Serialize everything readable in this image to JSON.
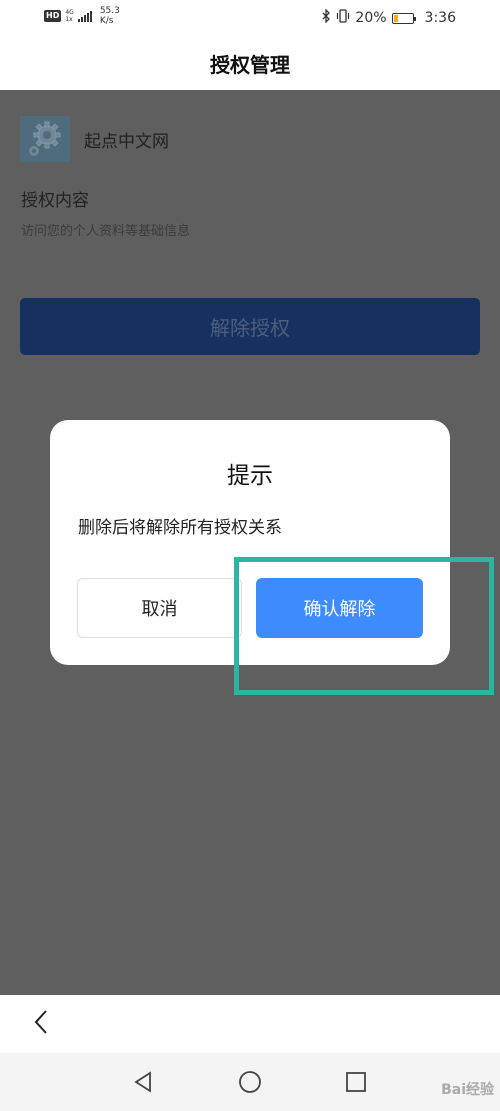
{
  "status_bar": {
    "hd": "HD",
    "network_gen": "4G",
    "network_sub": "1x",
    "speed_value": "55.3",
    "speed_unit": "K/s",
    "battery_percent": "20%",
    "battery_level": 0.2,
    "time": "3:36"
  },
  "header": {
    "title": "授权管理"
  },
  "app": {
    "name": "起点中文网",
    "logo_icon": "gear-icon"
  },
  "auth": {
    "content_label": "授权内容",
    "content_desc": "访问您的个人资料等基础信息",
    "revoke_label": "解除授权"
  },
  "dialog": {
    "title": "提示",
    "message": "删除后将解除所有授权关系",
    "cancel_label": "取消",
    "confirm_label": "确认解除"
  },
  "colors": {
    "primary": "#3d8bfd",
    "overlay": "#5f5f5f",
    "highlight": "#2bb5a3",
    "revoke_button": "#163160"
  },
  "watermark": "Bai经验"
}
